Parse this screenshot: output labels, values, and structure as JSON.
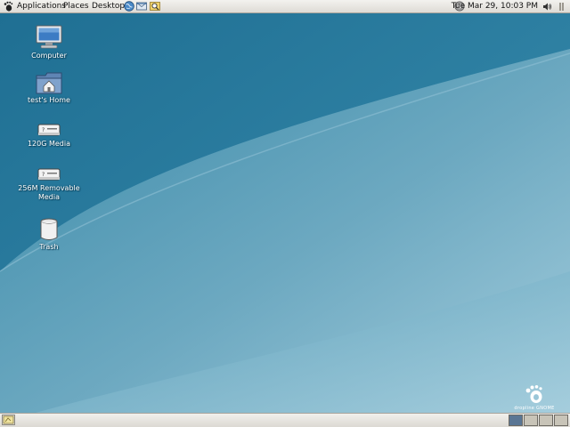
{
  "top_panel": {
    "menus": [
      "Applications",
      "Places",
      "Desktop"
    ],
    "launchers": [
      "web-browser-launcher",
      "email-launcher",
      "search-launcher"
    ],
    "clock": "Tue Mar 29, 10:03 PM"
  },
  "desktop": {
    "icons": [
      {
        "label": "Computer",
        "icon": "computer-icon"
      },
      {
        "label": "test's Home",
        "icon": "home-folder-icon"
      },
      {
        "label": "120G Media",
        "icon": "drive-icon"
      },
      {
        "label": "256M Removable Media",
        "icon": "removable-drive-icon"
      },
      {
        "label": "Trash",
        "icon": "trash-icon"
      }
    ],
    "logo_text": "dropline GNOME"
  },
  "bottom_panel": {
    "workspace_count": 4,
    "active_workspace": 1
  },
  "colors": {
    "wallpaper_dark": "#2c7da0",
    "wallpaper_light": "#a8cedd",
    "panel": "#e6e4df"
  }
}
